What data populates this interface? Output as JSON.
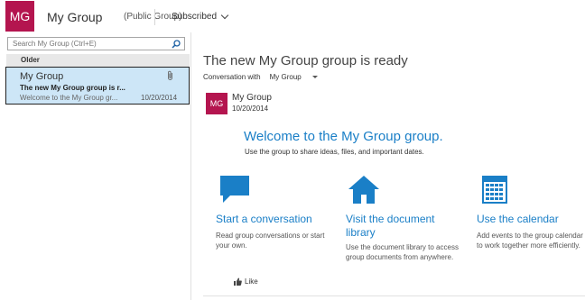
{
  "header": {
    "avatar_initials": "MG",
    "group_name": "My Group",
    "group_type": "(Public Group)",
    "subscribed_label": "Subscribed"
  },
  "left_pane": {
    "search_placeholder": "Search My Group (Ctrl+E)",
    "section_label": "Older",
    "conversations": [
      {
        "sender": "My Group",
        "subject": "The new My Group group is r...",
        "preview": "Welcome to the My Group gr...",
        "date": "10/20/2014",
        "has_attachment": true,
        "selected": true
      }
    ]
  },
  "reading_pane": {
    "thread_title": "The new My Group group is ready",
    "conversation_with_label": "Conversation with",
    "conversation_with_value": "My Group",
    "message": {
      "avatar_initials": "MG",
      "sender": "My Group",
      "date": "10/20/2014"
    },
    "welcome_title": "Welcome to the My Group group.",
    "welcome_subtitle": "Use the group to share ideas, files, and important dates.",
    "cards": [
      {
        "icon": "speech-bubble-icon",
        "title": "Start a conversation",
        "desc": "Read group conversations or start your own."
      },
      {
        "icon": "house-icon",
        "title": "Visit the document library",
        "desc": "Use the document library to access group documents from anywhere."
      },
      {
        "icon": "calendar-icon",
        "title": "Use the calendar",
        "desc": "Add events to the group calendar to work together more efficiently."
      }
    ],
    "like_label": "Like"
  },
  "colors": {
    "brand": "#b4154f",
    "accent": "#1a7fc7",
    "selected_bg": "#cde6f7"
  }
}
